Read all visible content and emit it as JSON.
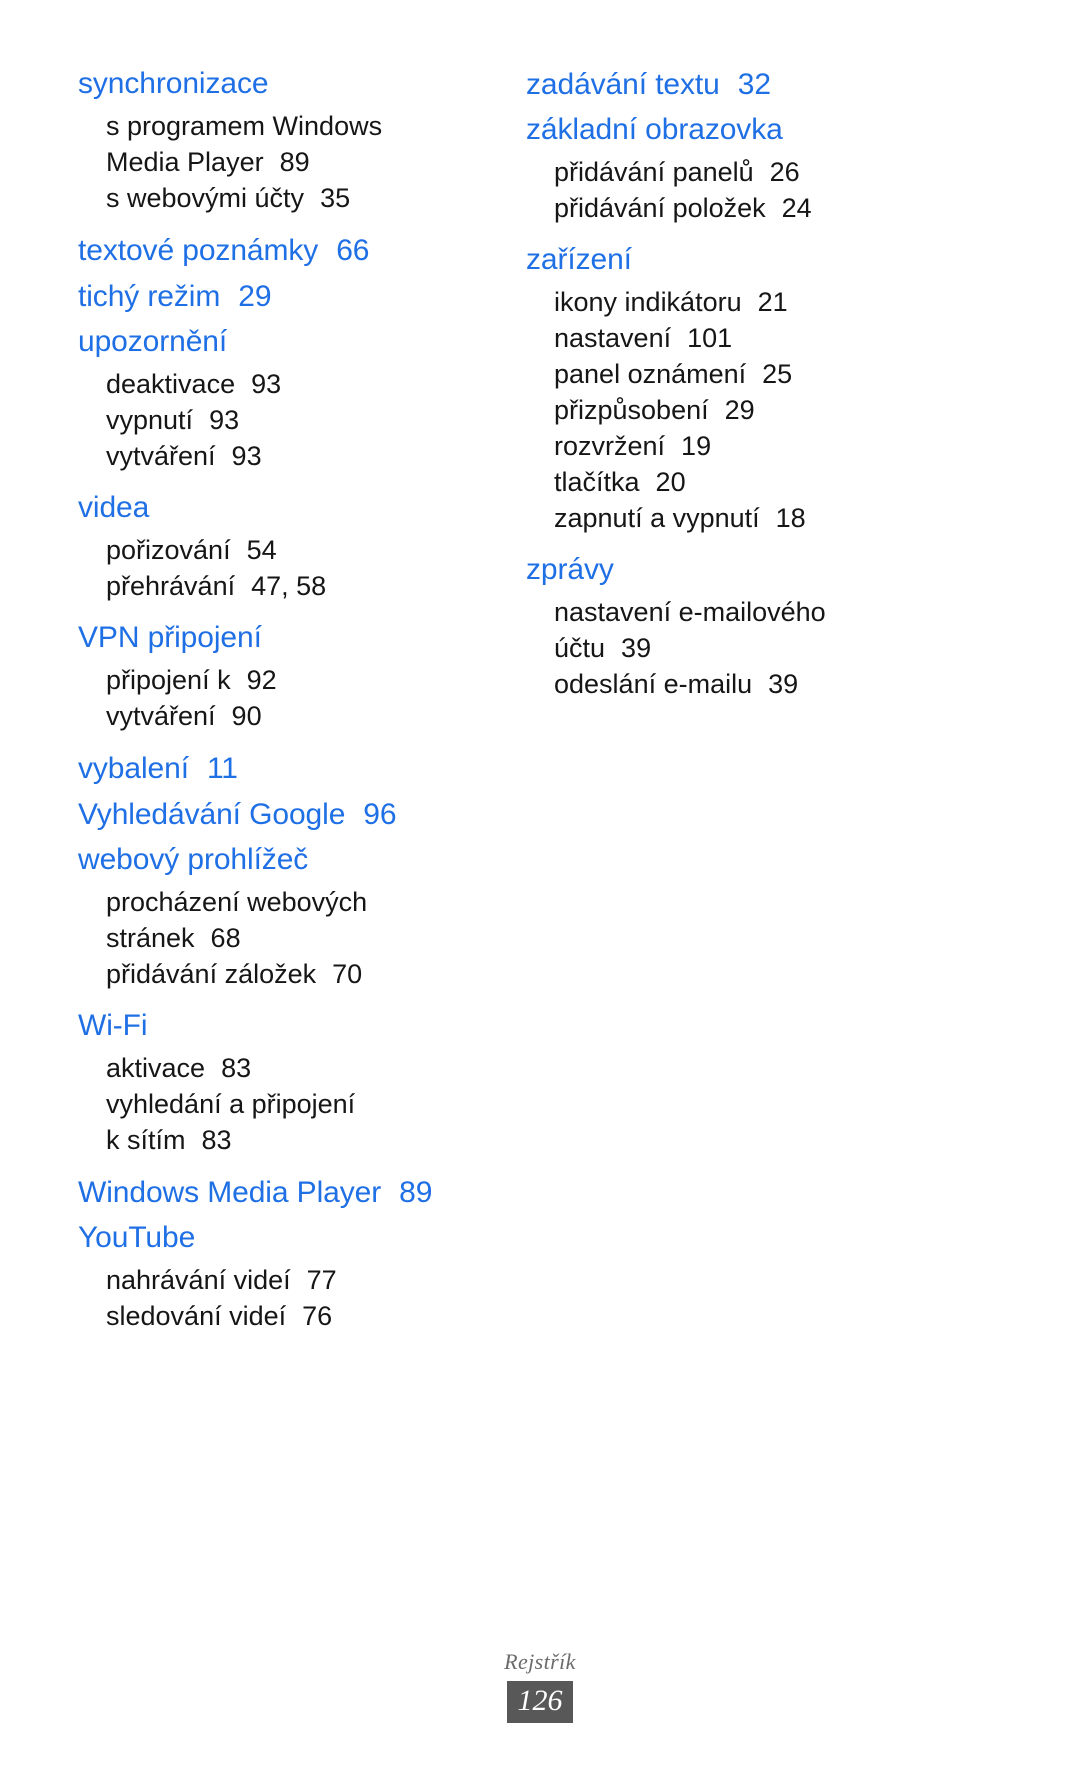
{
  "document": {
    "title": "Rejstřík",
    "page_number": "126",
    "heading_color": "#1f6fe5",
    "body_color": "#161616",
    "footer_color": "#6b6b6b",
    "page_badge_color": "#585858"
  },
  "columns": [
    {
      "id": "left",
      "groups": [
        {
          "head": "synchronizace",
          "page": "",
          "subs": [
            {
              "label": "s programem Windows",
              "page": ""
            },
            {
              "label": "Media Player",
              "page": "89"
            },
            {
              "label": "s webovými účty",
              "page": "35"
            }
          ]
        },
        {
          "head": "textové poznámky",
          "page": "66",
          "subs": []
        },
        {
          "head": "tichý režim",
          "page": "29",
          "subs": []
        },
        {
          "head": "upozornění",
          "page": "",
          "subs": [
            {
              "label": "deaktivace",
              "page": "93"
            },
            {
              "label": "vypnutí",
              "page": "93"
            },
            {
              "label": "vytváření",
              "page": "93"
            }
          ]
        },
        {
          "head": "videa",
          "page": "",
          "subs": [
            {
              "label": "pořizování",
              "page": "54"
            },
            {
              "label": "přehrávání",
              "page": "47, 58"
            }
          ]
        },
        {
          "head": "VPN připojení",
          "page": "",
          "subs": [
            {
              "label": "připojení k",
              "page": "92"
            },
            {
              "label": "vytváření",
              "page": "90"
            }
          ]
        },
        {
          "head": "vybalení",
          "page": "11",
          "subs": []
        },
        {
          "head": "Vyhledávání Google",
          "page": "96",
          "subs": []
        },
        {
          "head": "webový prohlížeč",
          "page": "",
          "subs": [
            {
              "label": "procházení webových",
              "page": ""
            },
            {
              "label": "stránek",
              "page": "68"
            },
            {
              "label": "přidávání záložek",
              "page": "70"
            }
          ]
        },
        {
          "head": "Wi-Fi",
          "page": "",
          "subs": [
            {
              "label": "aktivace",
              "page": "83"
            },
            {
              "label": "vyhledání a připojení",
              "page": ""
            },
            {
              "label": "k sítím",
              "page": "83"
            }
          ]
        },
        {
          "head": "Windows Media Player",
          "page": "89",
          "subs": []
        },
        {
          "head": "YouTube",
          "page": "",
          "subs": [
            {
              "label": "nahrávání videí",
              "page": "77"
            },
            {
              "label": "sledování videí",
              "page": "76"
            }
          ]
        }
      ]
    },
    {
      "id": "right",
      "groups": [
        {
          "head": "zadávání textu",
          "page": "32",
          "subs": []
        },
        {
          "head": "základní obrazovka",
          "page": "",
          "subs": [
            {
              "label": "přidávání panelů",
              "page": "26"
            },
            {
              "label": "přidávání položek",
              "page": "24"
            }
          ]
        },
        {
          "head": "zařízení",
          "page": "",
          "subs": [
            {
              "label": "ikony indikátoru",
              "page": "21"
            },
            {
              "label": "nastavení",
              "page": "101"
            },
            {
              "label": "panel oznámení",
              "page": "25"
            },
            {
              "label": "přizpůsobení",
              "page": "29"
            },
            {
              "label": "rozvržení",
              "page": "19"
            },
            {
              "label": "tlačítka",
              "page": "20"
            },
            {
              "label": "zapnutí a vypnutí",
              "page": "18"
            }
          ]
        },
        {
          "head": "zprávy",
          "page": "",
          "subs": [
            {
              "label": "nastavení e-mailového",
              "page": ""
            },
            {
              "label": "účtu",
              "page": "39"
            },
            {
              "label": "odeslání e-mailu",
              "page": "39"
            }
          ]
        }
      ]
    }
  ]
}
